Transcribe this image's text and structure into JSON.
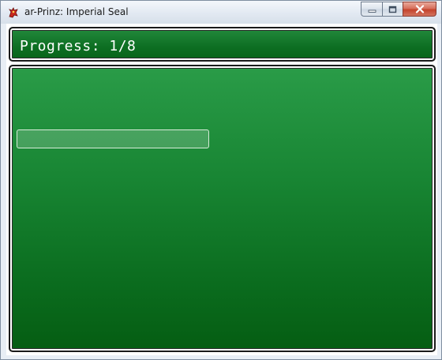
{
  "window": {
    "title": "ar-Prinz: Imperial Seal",
    "app_icon": "dragon-icon",
    "controls": {
      "minimize": "minimize-icon",
      "maximize": "maximize-icon",
      "close": "close-icon"
    }
  },
  "game": {
    "progress_label": "Progress: 1/8",
    "selection_box_text": ""
  },
  "colors": {
    "panel_green": "#188533",
    "panel_border": "#1a1a1a",
    "text": "#ffffff"
  }
}
